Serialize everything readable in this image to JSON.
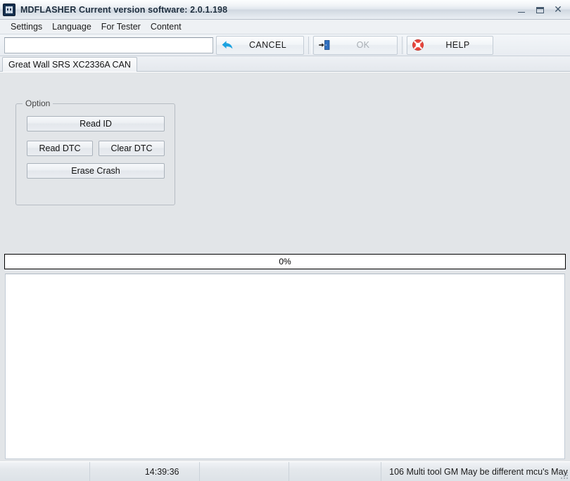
{
  "window": {
    "title": "MDFLASHER  Current version software: 2.0.1.198",
    "icon": "app-icon",
    "controls": {
      "minimize": "minimize-icon",
      "maximize": "maximize-icon",
      "close": "close-icon"
    }
  },
  "menubar": {
    "items": [
      {
        "label": "Settings"
      },
      {
        "label": "Language"
      },
      {
        "label": "For Tester"
      },
      {
        "label": "Content"
      }
    ]
  },
  "toolbar": {
    "input": {
      "value": "",
      "placeholder": ""
    },
    "buttons": [
      {
        "label": "CANCEL",
        "icon": "back-arrow-icon",
        "enabled": true
      },
      {
        "label": "OK",
        "icon": "exit-door-icon",
        "enabled": false
      },
      {
        "label": "HELP",
        "icon": "lifebuoy-icon",
        "enabled": true
      }
    ]
  },
  "tabs": [
    {
      "label": "Great Wall SRS XC2336A  CAN",
      "active": true
    }
  ],
  "option_group": {
    "title": "Option",
    "buttons": [
      {
        "label": "Read ID"
      },
      {
        "label": "Read DTC"
      },
      {
        "label": "Clear DTC"
      },
      {
        "label": "Erase Crash"
      }
    ]
  },
  "progress": {
    "label": "0%",
    "percent": 0
  },
  "log": {
    "text": ""
  },
  "statusbar": {
    "panels": [
      {
        "text": ""
      },
      {
        "text": "14:39:36"
      },
      {
        "text": ""
      },
      {
        "text": ""
      },
      {
        "text": "106 Multi tool GM May be different mcu's May"
      }
    ],
    "grip": "resize-grip-icon"
  },
  "colors": {
    "background": "#e2e5e8",
    "accent_blue": "#1ca2e0",
    "help_red": "#e8453c",
    "titlebar_text": "#203040"
  }
}
